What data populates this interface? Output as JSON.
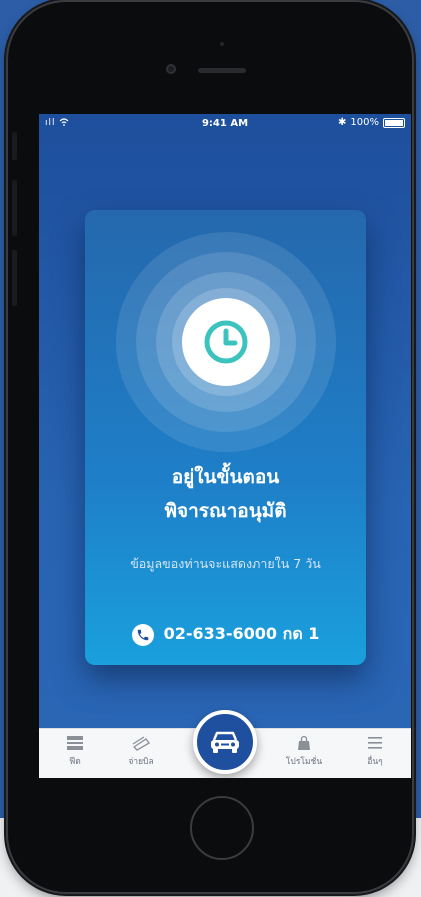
{
  "statusbar": {
    "signal": "ıll",
    "time": "9:41 AM",
    "battery": "100%"
  },
  "card": {
    "title_line1": "อยู่ในขั้นตอน",
    "title_line2": "พิจารณาอนุมัติ",
    "description": "ข้อมูลของท่านจะแสดงภายใน 7 วัน",
    "phone": "02-633-6000 กด 1"
  },
  "tabbar": {
    "home_label": "ฟีด",
    "bill_label": "จ่ายบิล",
    "promo_label": "โปรโมชั่น",
    "other_label": "อื่นๆ"
  },
  "colors": {
    "background": "#2c5da6",
    "screen": "#2864b3",
    "card_top": "#2568ad",
    "card_bottom": "#1aa0dd",
    "clock_accent": "#3cc3bd",
    "tab_inactive": "#6b7280",
    "center_button": "#1f4f9f"
  },
  "icons": {
    "clock": "clock-icon",
    "phone": "phone-icon",
    "car": "car-icon",
    "feed": "feed-icon",
    "bill": "bill-icon",
    "promo": "shopping-bag-icon",
    "other": "menu-icon"
  }
}
